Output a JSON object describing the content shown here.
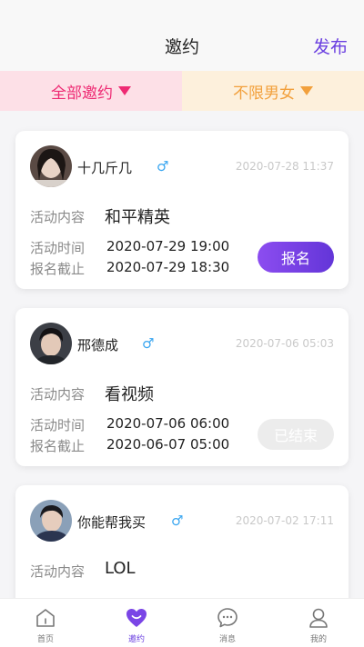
{
  "header": {
    "title": "邀约",
    "publish_label": "发布"
  },
  "filters": [
    {
      "label": "全部邀约",
      "color": "#ee2a73"
    },
    {
      "label": "不限男女",
      "color": "#f2a03c"
    }
  ],
  "labels": {
    "content": "活动内容",
    "activity_time": "活动时间",
    "deadline": "报名截止"
  },
  "cards": [
    {
      "name": "十几斤几",
      "gender_icon": "male-icon",
      "posted": "2020-07-28 11:37",
      "content": "和平精英",
      "activity_time": "2020-07-29 19:00",
      "deadline": "2020-07-29 18:30",
      "button": "报名",
      "status": "open"
    },
    {
      "name": "邢德成",
      "gender_icon": "male-icon",
      "posted": "2020-07-06 05:03",
      "content": "看视频",
      "activity_time": "2020-07-06 06:00",
      "deadline": "2020-06-07 05:00",
      "button": "已结束",
      "status": "ended"
    },
    {
      "name": "你能帮我买",
      "gender_icon": "male-icon",
      "posted": "2020-07-02 17:11",
      "content": "LOL"
    }
  ],
  "tabbar": [
    {
      "label": "首页",
      "icon": "home-icon"
    },
    {
      "label": "邀约",
      "icon": "invite-heart-icon",
      "active": true
    },
    {
      "label": "消息",
      "icon": "message-icon"
    },
    {
      "label": "我的",
      "icon": "profile-icon"
    }
  ],
  "colors": {
    "accent": "#6a3fe0",
    "male": "#3aa6f0"
  }
}
